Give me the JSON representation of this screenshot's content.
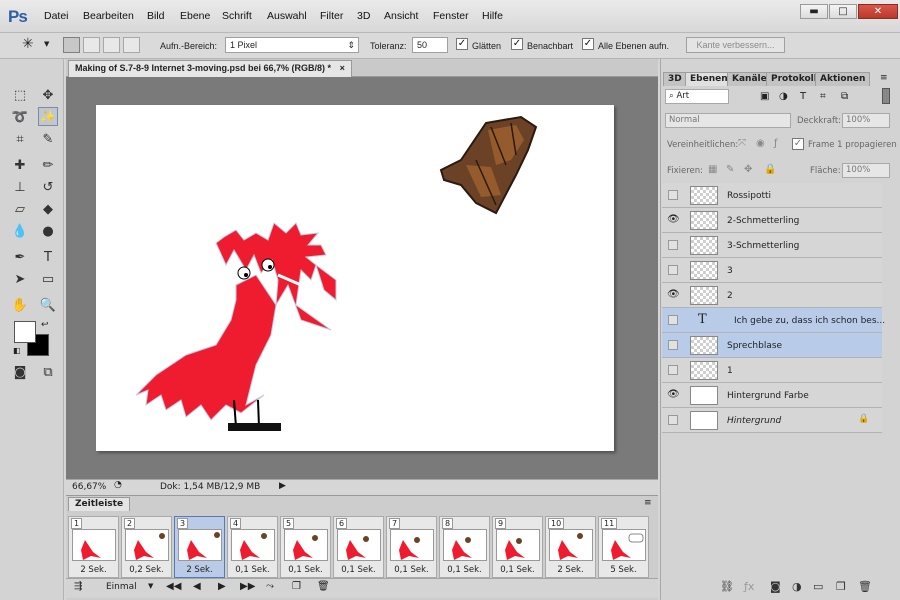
{
  "app": {
    "logo": "Ps"
  },
  "menu": [
    "Datei",
    "Bearbeiten",
    "Bild",
    "Ebene",
    "Schrift",
    "Auswahl",
    "Filter",
    "3D",
    "Ansicht",
    "Fenster",
    "Hilfe"
  ],
  "window_controls": {
    "minimize": "▬",
    "maximize": "□",
    "close": "✕"
  },
  "options_bar": {
    "sample_size_label": "Aufn.-Bereich:",
    "sample_size_value": "1 Pixel",
    "tolerance_label": "Toleranz:",
    "tolerance_value": "50",
    "antialias_label": "Glätten",
    "contiguous_label": "Benachbart",
    "all_layers_label": "Alle Ebenen aufn.",
    "refine_label": "Kante verbessern..."
  },
  "document": {
    "tab_title": "Making of S.7-8-9 Internet 3-moving.psd bei 66,7% (RGB/8) *",
    "close": "×",
    "zoom": "66,67%",
    "doc_info": "Dok: 1,54 MB/12,9 MB"
  },
  "timeline": {
    "tab": "Zeitleiste",
    "frames": [
      {
        "num": "1",
        "duration": "2 Sek."
      },
      {
        "num": "2",
        "duration": "0,2 Sek."
      },
      {
        "num": "3",
        "duration": "2 Sek."
      },
      {
        "num": "4",
        "duration": "0,1 Sek."
      },
      {
        "num": "5",
        "duration": "0,1 Sek."
      },
      {
        "num": "6",
        "duration": "0,1 Sek."
      },
      {
        "num": "7",
        "duration": "0,1 Sek."
      },
      {
        "num": "8",
        "duration": "0,1 Sek."
      },
      {
        "num": "9",
        "duration": "0,1 Sek."
      },
      {
        "num": "10",
        "duration": "2 Sek."
      },
      {
        "num": "11",
        "duration": "5 Sek."
      }
    ],
    "selected_frame": 3,
    "loop": "Einmal"
  },
  "panel": {
    "tabs": [
      "3D",
      "Ebenen",
      "Kanäle",
      "Protokoll",
      "Aktionen"
    ],
    "active_tab": "Ebenen",
    "filter_kind": "Art",
    "blend_mode": "Normal",
    "opacity_label": "Deckkraft:",
    "opacity_value": "100%",
    "unify_label": "Vereinheitlichen:",
    "propagate_label": "Frame 1 propagieren",
    "lock_label": "Fixieren:",
    "fill_label": "Fläche:",
    "fill_value": "100%",
    "layers": [
      {
        "name": "Rossipotti",
        "visible": false,
        "selected": false,
        "type": "pixel"
      },
      {
        "name": "2-Schmetterling",
        "visible": true,
        "selected": false,
        "type": "pixel"
      },
      {
        "name": "3-Schmetterling",
        "visible": false,
        "selected": false,
        "type": "pixel"
      },
      {
        "name": "3",
        "visible": false,
        "selected": false,
        "type": "pixel"
      },
      {
        "name": "2",
        "visible": true,
        "selected": false,
        "type": "pixel"
      },
      {
        "name": "Ich gebe zu, dass ich schon bes...",
        "visible": false,
        "selected": true,
        "type": "text"
      },
      {
        "name": "Sprechblase",
        "visible": false,
        "selected": true,
        "type": "pixel"
      },
      {
        "name": "1",
        "visible": false,
        "selected": false,
        "type": "pixel"
      },
      {
        "name": "Hintergrund Farbe",
        "visible": true,
        "selected": false,
        "type": "fill"
      },
      {
        "name": "Hintergrund",
        "visible": false,
        "selected": false,
        "type": "background"
      }
    ]
  },
  "colors": {
    "accent": "#2d5ea8",
    "dragon_red": "#ee1c2e",
    "selection": "#b8ccea"
  }
}
